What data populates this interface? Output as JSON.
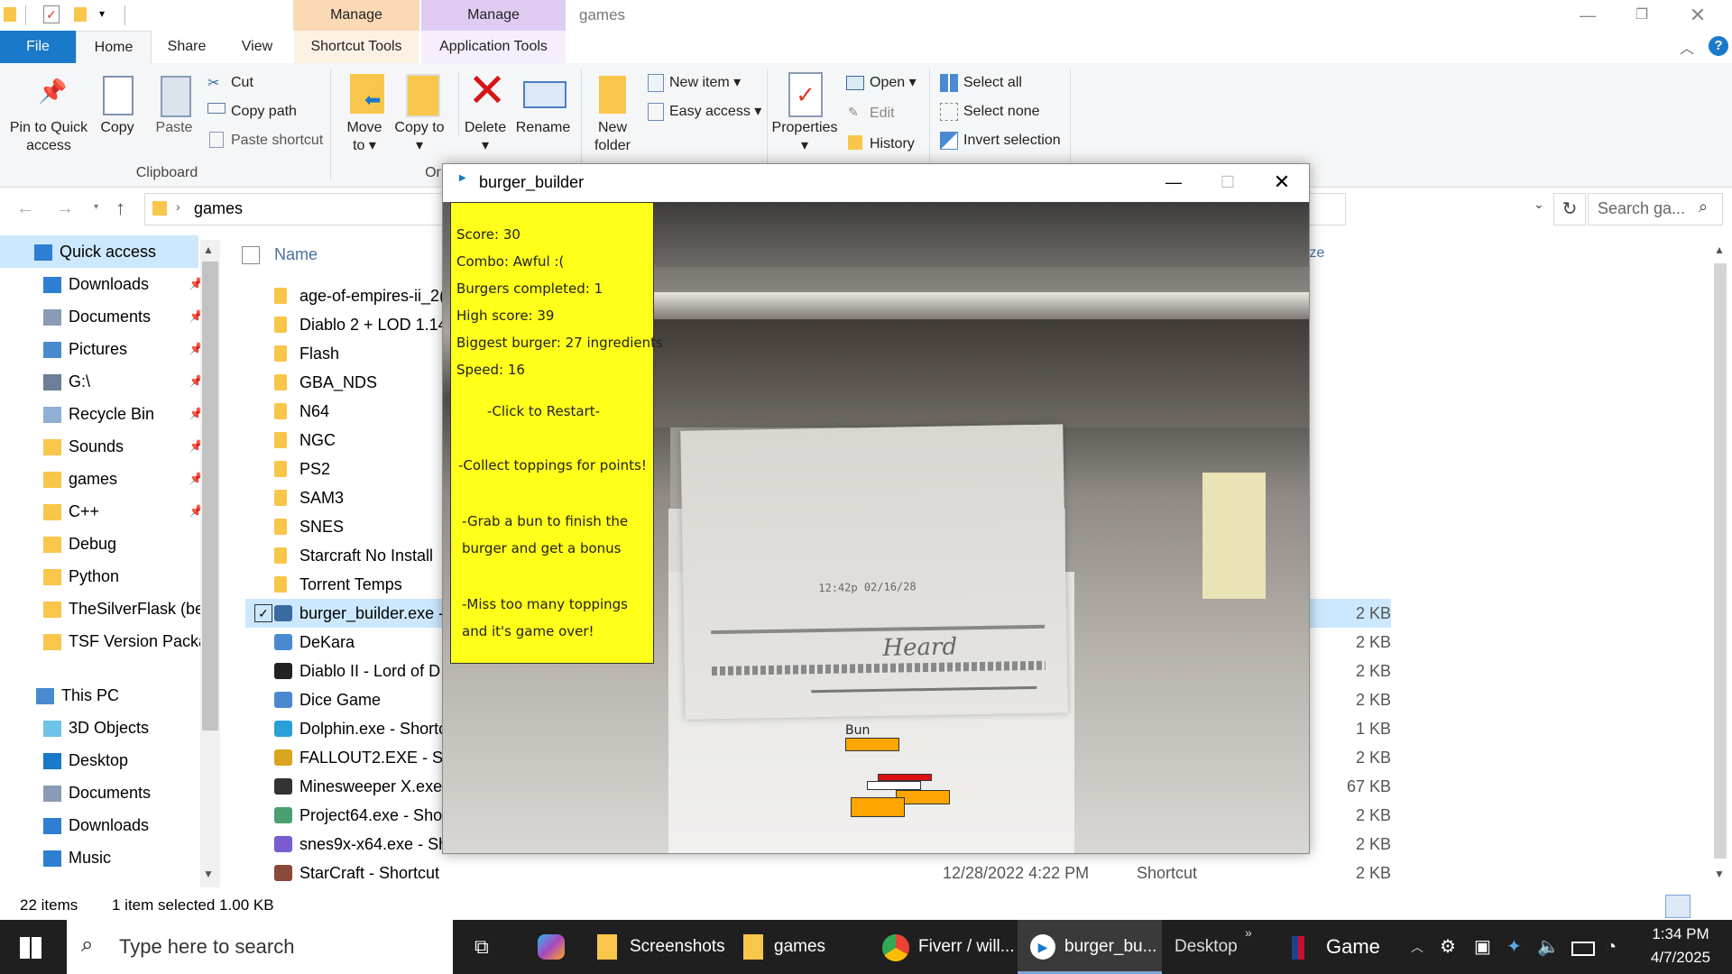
{
  "explorer": {
    "window_title": "games",
    "context_tabs": [
      "Manage",
      "Manage"
    ],
    "ribbon_tabs": [
      "File",
      "Home",
      "Share",
      "View",
      "Shortcut Tools",
      "Application Tools"
    ],
    "clipboard": {
      "pin_label": "Pin to Quick access",
      "copy_label": "Copy",
      "paste_label": "Paste",
      "cut_label": "Cut",
      "copy_path_label": "Copy path",
      "paste_shortcut_label": "Paste shortcut",
      "group_label": "Clipboard"
    },
    "organize": {
      "move_label": "Move to",
      "copy_to_label": "Copy to",
      "delete_label": "Delete",
      "rename_label": "Rename",
      "group_label_partial": "Or"
    },
    "new": {
      "new_folder_label": "New folder",
      "new_item_label": "New item",
      "easy_access_label": "Easy access"
    },
    "open": {
      "properties_label": "Properties",
      "open_label": "Open",
      "edit_label": "Edit",
      "history_label": "History"
    },
    "select": {
      "select_all_label": "Select all",
      "select_none_label": "Select none",
      "invert_label": "Invert selection"
    },
    "address": {
      "path": "games",
      "search_placeholder": "Search ga..."
    },
    "columns": {
      "name": "Name",
      "size_partial": "ize"
    },
    "nav": [
      {
        "label": "Quick access",
        "icon": "star-icon",
        "pinned": false
      },
      {
        "label": "Downloads",
        "icon": "download-icon",
        "pinned": true
      },
      {
        "label": "Documents",
        "icon": "documents-icon",
        "pinned": true
      },
      {
        "label": "Pictures",
        "icon": "pictures-icon",
        "pinned": true
      },
      {
        "label": "G:\\",
        "icon": "drive-icon",
        "pinned": true
      },
      {
        "label": "Recycle Bin",
        "icon": "recycle-bin-icon",
        "pinned": true
      },
      {
        "label": "Sounds",
        "icon": "folder-icon",
        "pinned": true
      },
      {
        "label": "games",
        "icon": "folder-icon",
        "pinned": true
      },
      {
        "label": "C++",
        "icon": "folder-icon",
        "pinned": true
      },
      {
        "label": "Debug",
        "icon": "folder-icon",
        "pinned": false
      },
      {
        "label": "Python",
        "icon": "folder-icon",
        "pinned": false
      },
      {
        "label": "TheSilverFlask (bet",
        "icon": "folder-icon",
        "pinned": false
      },
      {
        "label": "TSF Version Packaç",
        "icon": "folder-icon",
        "pinned": false
      },
      {
        "label": "This PC",
        "icon": "computer-icon",
        "pinned": false
      },
      {
        "label": "3D Objects",
        "icon": "3d-objects-icon",
        "pinned": false
      },
      {
        "label": "Desktop",
        "icon": "desktop-icon",
        "pinned": false
      },
      {
        "label": "Documents",
        "icon": "documents-icon",
        "pinned": false
      },
      {
        "label": "Downloads",
        "icon": "download-icon",
        "pinned": false
      },
      {
        "label": "Music",
        "icon": "music-icon",
        "pinned": false
      }
    ],
    "files": [
      {
        "name": "age-of-empires-ii_2(",
        "size": "",
        "type": "folder"
      },
      {
        "name": "Diablo 2 + LOD 1.14",
        "size": "",
        "type": "folder"
      },
      {
        "name": "Flash",
        "size": "",
        "type": "folder"
      },
      {
        "name": "GBA_NDS",
        "size": "",
        "type": "folder"
      },
      {
        "name": "N64",
        "size": "",
        "type": "folder"
      },
      {
        "name": "NGC",
        "size": "",
        "type": "folder"
      },
      {
        "name": "PS2",
        "size": "",
        "type": "folder"
      },
      {
        "name": "SAM3",
        "size": "",
        "type": "folder"
      },
      {
        "name": "SNES",
        "size": "",
        "type": "folder"
      },
      {
        "name": "Starcraft No Install",
        "size": "",
        "type": "folder"
      },
      {
        "name": "Torrent Temps",
        "size": "",
        "type": "folder"
      },
      {
        "name": "burger_builder.exe -",
        "size": "2 KB",
        "type": "shortcut",
        "selected": true
      },
      {
        "name": "DeKara",
        "size": "2 KB",
        "type": "shortcut"
      },
      {
        "name": "Diablo II - Lord of D",
        "size": "2 KB",
        "type": "shortcut"
      },
      {
        "name": "Dice Game",
        "size": "2 KB",
        "type": "shortcut"
      },
      {
        "name": "Dolphin.exe - Shortc",
        "size": "1 KB",
        "type": "shortcut"
      },
      {
        "name": "FALLOUT2.EXE - Sho",
        "size": "2 KB",
        "type": "shortcut"
      },
      {
        "name": "Minesweeper X.exe",
        "size": "67 KB",
        "type": "shortcut"
      },
      {
        "name": "Project64.exe - Shor",
        "size": "2 KB",
        "type": "shortcut"
      },
      {
        "name": "snes9x-x64.exe - Sh",
        "size": "2 KB",
        "type": "shortcut"
      },
      {
        "name": "StarCraft - Shortcut",
        "size": "2 KB",
        "type": "shortcut",
        "date": "12/28/2022 4:22 PM",
        "kind": "Shortcut"
      }
    ],
    "status": {
      "items": "22 items",
      "selected": "1 item selected  1.00 KB"
    }
  },
  "game": {
    "title": "burger_builder",
    "stats": [
      "Score: 30",
      "Combo: Awful :(",
      "Burgers completed: 1",
      "High score: 39",
      "Biggest burger: 27 ingredients",
      "Speed: 16"
    ],
    "restart": "-Click to Restart-",
    "instructions": [
      "-Collect toppings for points!",
      "-Grab a bun to finish the",
      "burger and get a bonus",
      "-Miss too many toppings",
      "and it's game over!"
    ],
    "falling_label": "Bun",
    "colors": {
      "panel": "#ffff1a",
      "bun": "#ffa500",
      "tomato": "#dd1111"
    }
  },
  "taskbar": {
    "search_placeholder": "Type here to search",
    "apps": [
      "Screenshots",
      "games",
      "Fiverr / will...",
      "burger_bu..."
    ],
    "desktop_label": "Desktop",
    "game_label": "Game",
    "time": "1:34 PM",
    "date": "4/7/2025"
  }
}
